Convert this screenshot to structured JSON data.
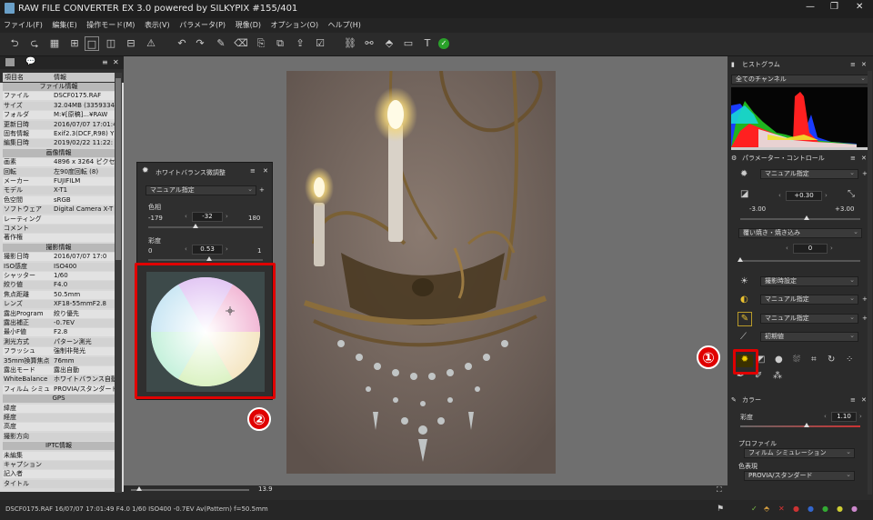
{
  "window": {
    "title": "RAW FILE CONVERTER EX 3.0 powered by SILKYPIX   #155/401",
    "controls": [
      "—",
      "❐",
      "✕"
    ]
  },
  "menu": [
    "ファイル(F)",
    "編集(E)",
    "操作モード(M)",
    "表示(V)",
    "パラメータ(P)",
    "現像(D)",
    "オプション(O)",
    "ヘルプ(H)"
  ],
  "toolbar": {
    "icons": [
      "rotate-left-icon",
      "rotate-right-icon",
      "grid-icon",
      "grid-large-icon",
      "single-view-icon",
      "compare-icon",
      "split-icon",
      "warning-icon",
      "undo-icon",
      "redo-icon",
      "brush-icon",
      "eraser-icon",
      "paste-icon",
      "copy-icon",
      "export-icon",
      "checklist-icon",
      "network-icon",
      "network2-icon",
      "tag-icon",
      "display-icon",
      "text-icon",
      "check-circle-icon"
    ]
  },
  "left_panel": {
    "header_cols": [
      "項目名",
      "情報"
    ],
    "sections": [
      {
        "title": "ファイル情報",
        "rows": [
          [
            "ファイル",
            "DSCF0175.RAF"
          ],
          [
            "サイズ",
            "32.04MB (3359334"
          ],
          [
            "フォルダ",
            "M:¥[原稿]...¥RAW"
          ],
          [
            "更新日時",
            "2016/07/07 17:01:4"
          ],
          [
            "固有情報",
            "Exif2.3(DCF,R98) Y"
          ],
          [
            "編集日時",
            "2019/02/22 11:22:"
          ]
        ]
      },
      {
        "title": "画像情報",
        "rows": [
          [
            "画素",
            "4896 x 3264 ピクセ"
          ],
          [
            "回転",
            "左90度回転 (8)"
          ],
          [
            "メーカー",
            "FUJIFILM"
          ],
          [
            "モデル",
            "X-T1"
          ],
          [
            "色空間",
            "sRGB"
          ],
          [
            "ソフトウェア",
            "Digital Camera X-T"
          ],
          [
            "レーティング",
            ""
          ],
          [
            "コメント",
            ""
          ],
          [
            "著作権",
            ""
          ]
        ]
      },
      {
        "title": "撮影情報",
        "rows": [
          [
            "撮影日時",
            "2016/07/07 17:0"
          ],
          [
            "ISO感度",
            "ISO400"
          ],
          [
            "シャッター",
            "1/60"
          ],
          [
            "絞り値",
            "F4.0"
          ],
          [
            "焦点距離",
            "50.5mm"
          ],
          [
            "レンズ",
            "XF18-55mmF2.8"
          ],
          [
            "露出Program",
            "絞り優先"
          ],
          [
            "露出補正",
            "-0.7EV"
          ],
          [
            "最小F値",
            "F2.8"
          ],
          [
            "測光方式",
            "パターン測光"
          ],
          [
            "フラッシュ",
            "強制非発光"
          ],
          [
            "35mm換算焦点",
            "76mm"
          ],
          [
            "露出モード",
            "露出自動"
          ],
          [
            "WhiteBalance",
            "ホワイトバランス自動"
          ],
          [
            "フィルム シミュレ",
            "PROVIA/スタンダード"
          ]
        ]
      },
      {
        "title": "GPS",
        "rows": [
          [
            "緯度",
            ""
          ],
          [
            "経度",
            ""
          ],
          [
            "高度",
            ""
          ],
          [
            "撮影方向",
            ""
          ]
        ]
      },
      {
        "title": "IPTC情報",
        "rows": [
          [
            "未編集",
            ""
          ],
          [
            "キャプション",
            ""
          ],
          [
            "記入者",
            ""
          ],
          [
            "タイトル",
            ""
          ]
        ]
      }
    ]
  },
  "wb_panel": {
    "title": "ホワイトバランス微調整",
    "preset": "マニュアル指定",
    "hue_label": "色相",
    "hue_min": "-179",
    "hue_max": "180",
    "hue_value": "-32",
    "hue_pos": 0.41,
    "sat_label": "彩度",
    "sat_min": "0",
    "sat_max": "1",
    "sat_value": "0.53",
    "sat_pos": 0.53
  },
  "viewer": {
    "zoom": "13.9"
  },
  "status": {
    "text": "DSCF0175.RAF 16/07/07 17:01:49 F4.0 1/60 ISO400 -0.7EV Av(Pattern) f=50.5mm"
  },
  "right_panel": {
    "histogram": {
      "title": "ヒストグラム",
      "channel": "全てのチャンネル"
    },
    "param": {
      "title": "パラメーター・コントロール",
      "wb_preset": "マニュアル指定",
      "exposure_value": "+0.30",
      "exposure_min": "-3.00",
      "exposure_max": "+3.00",
      "exposure_pos": 0.55,
      "tone_mode": "覆い焼き・焼き込み",
      "tone_value": "0",
      "tone_pos": 0.0,
      "shoot_setting": "撮影時設定",
      "contrast_preset": "マニュアル指定",
      "sharpness_preset": "マニュアル指定",
      "noise_preset": "初期値"
    },
    "color": {
      "title": "カラー",
      "sat_label": "彩度",
      "sat_value": "1.10",
      "sat_pos": 0.55,
      "profile_label": "プロファイル",
      "profile_value": "フィルム シミュレーション",
      "color_label": "色表現",
      "color_value": "PROVIA/スタンダード"
    }
  },
  "callouts": [
    "①",
    "②"
  ]
}
